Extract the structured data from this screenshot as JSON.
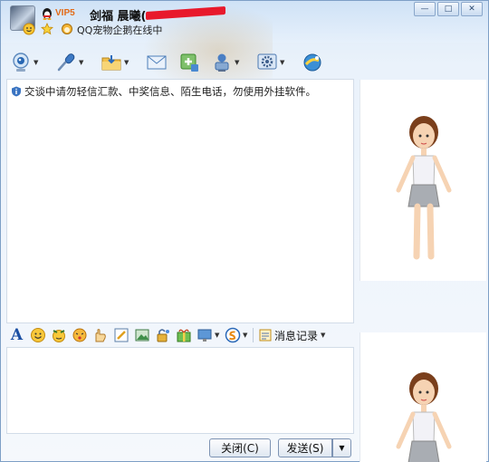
{
  "header": {
    "vip_badge": "VIP5",
    "contact_name": "剑福 晨曦(",
    "status_text": "QQ宠物企鹅在线中"
  },
  "window_controls": {
    "minimize": "—",
    "maximize": "□",
    "close": "✕"
  },
  "toolbar": {
    "items": [
      "video-call",
      "voice-call",
      "send-file",
      "send-sms",
      "invite-group",
      "remote-assist",
      "app-settings",
      "qq-apps"
    ]
  },
  "chat": {
    "notice": "交谈中请勿轻信汇款、中奖信息、陌生电话，勿使用外挂软件。"
  },
  "format_bar": {
    "font_label": "A",
    "history_label": "消息记录"
  },
  "buttons": {
    "close_label": "关闭(C)",
    "send_label": "发送(S)",
    "send_arrow": "▼"
  },
  "colors": {
    "accent": "#1b4fa3",
    "frame": "#7d9fc6",
    "redaction": "#e8192b"
  }
}
